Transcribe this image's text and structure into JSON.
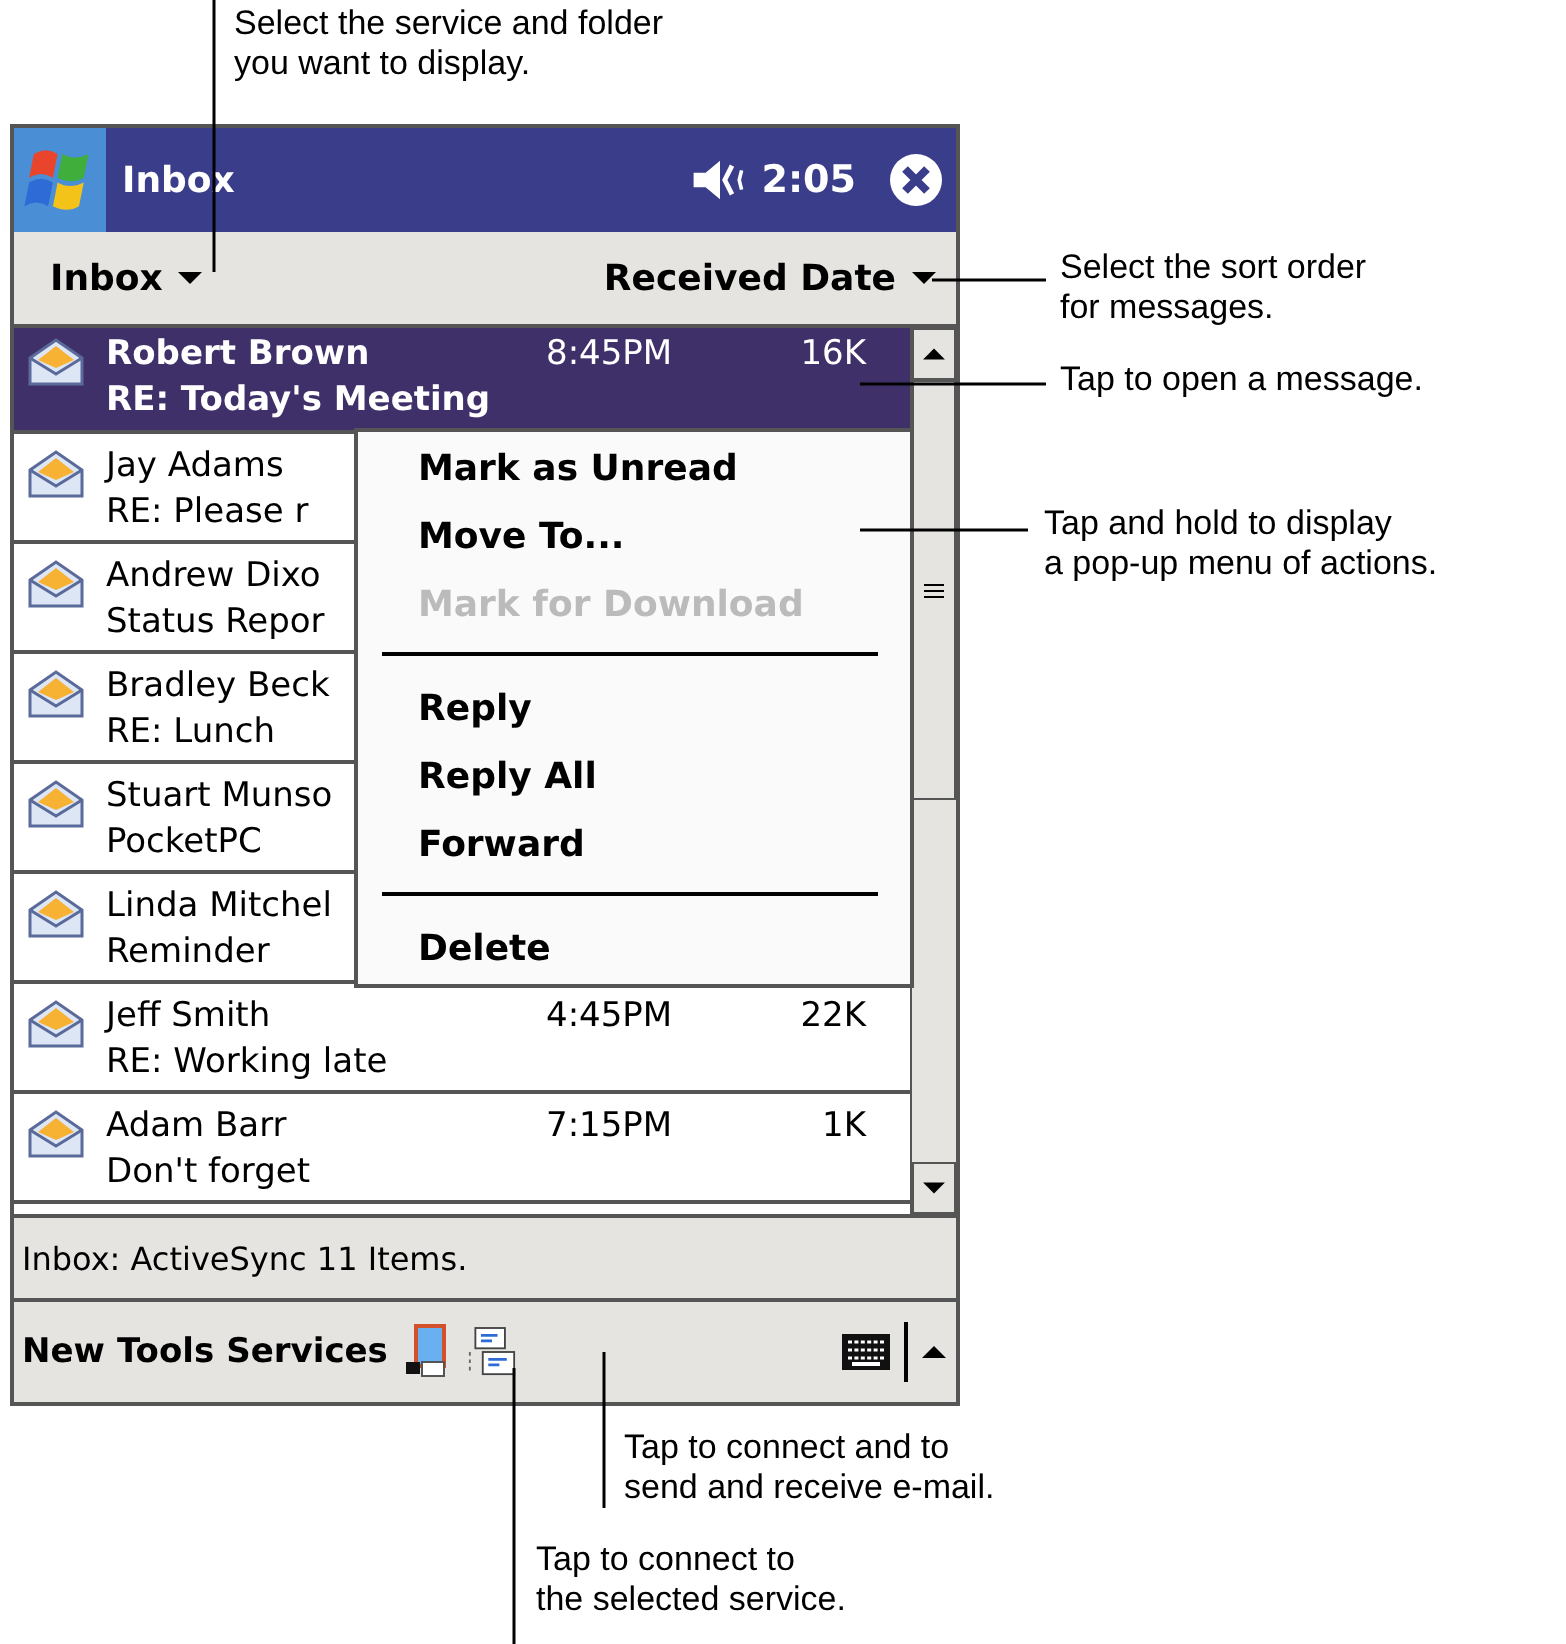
{
  "window": {
    "title": "Inbox",
    "time": "2:05"
  },
  "menu_bar": {
    "folder": "Inbox",
    "sort": "Received Date"
  },
  "messages": [
    {
      "sender": "Robert Brown",
      "time": "8:45PM",
      "size": "16K",
      "subject": "RE: Today's Meeting",
      "selected": true
    },
    {
      "sender": "Jay Adams",
      "subject": "RE: Please r",
      "selected": false
    },
    {
      "sender": "Andrew Dixo",
      "subject": "Status Repor",
      "selected": false
    },
    {
      "sender": "Bradley Beck",
      "subject": "RE: Lunch",
      "selected": false
    },
    {
      "sender": "Stuart Munso",
      "subject": "PocketPC",
      "selected": false
    },
    {
      "sender": "Linda Mitchel",
      "subject": "Reminder",
      "selected": false
    },
    {
      "sender": "Jeff Smith",
      "time": "4:45PM",
      "size": "22K",
      "subject": "RE: Working late",
      "selected": false
    },
    {
      "sender": "Adam Barr",
      "time": "7:15PM",
      "size": "1K",
      "subject": "Don't forget",
      "selected": false
    }
  ],
  "context_menu": [
    {
      "kind": "item",
      "label": "Mark as Unread",
      "disabled": false
    },
    {
      "kind": "item",
      "label": "Move To...",
      "disabled": false
    },
    {
      "kind": "item",
      "label": "Mark for Download",
      "disabled": true
    },
    {
      "kind": "separator"
    },
    {
      "kind": "item",
      "label": "Reply",
      "disabled": false
    },
    {
      "kind": "item",
      "label": "Reply All",
      "disabled": false
    },
    {
      "kind": "item",
      "label": "Forward",
      "disabled": false
    },
    {
      "kind": "separator"
    },
    {
      "kind": "item",
      "label": "Delete",
      "disabled": false
    }
  ],
  "status_bar": "Inbox: ActiveSync  11 Items.",
  "toolbar": {
    "menus": [
      "New",
      "Tools",
      "Services"
    ]
  },
  "callouts": [
    {
      "text": "Select the service and folder\nyou want to display."
    },
    {
      "text": "Select the sort order\nfor messages."
    },
    {
      "text": "Tap to open a message."
    },
    {
      "text": "Tap and hold to display\na pop-up menu of actions."
    },
    {
      "text": "Tap to connect and to\nsend and receive e-mail."
    },
    {
      "text": "Tap to connect to\nthe selected service."
    }
  ]
}
